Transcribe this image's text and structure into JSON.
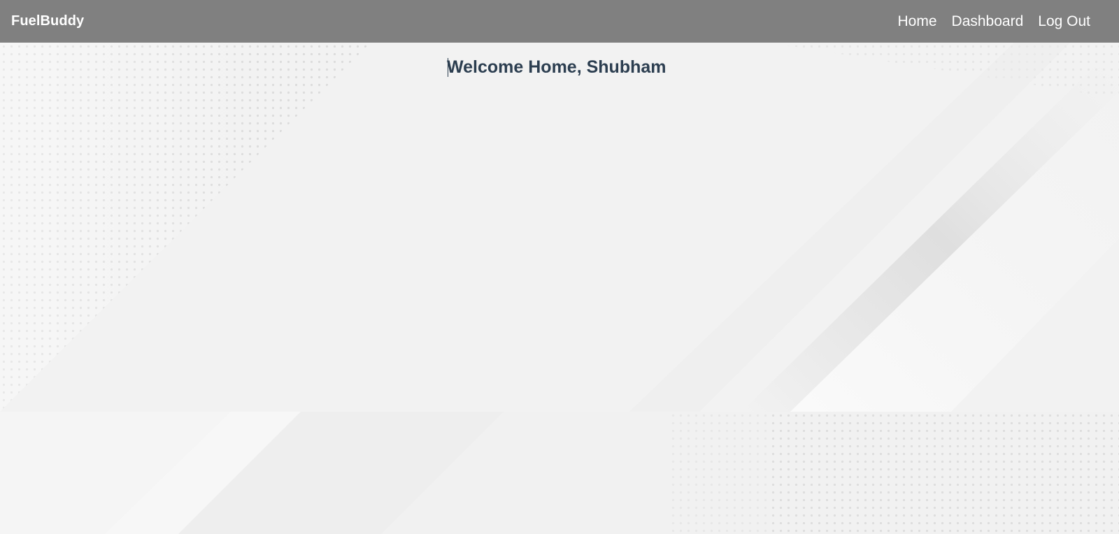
{
  "navbar": {
    "brand": "FuelBuddy",
    "links": [
      "Home",
      "Dashboard",
      "Log Out"
    ]
  },
  "main": {
    "welcome_text": "Welcome Home, Shubham"
  },
  "colors": {
    "navbar_bg": "#808080",
    "navbar_text": "#ffffff",
    "heading": "#2c3e50",
    "page_bg": "#f2f2f2"
  }
}
